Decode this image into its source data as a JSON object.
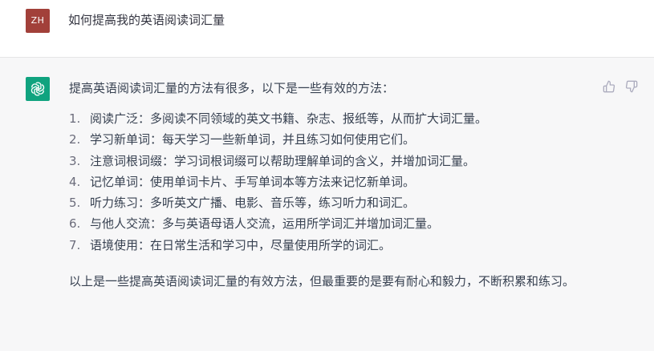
{
  "user_message": {
    "avatar_initials": "ZH",
    "avatar_color": "#a2403a",
    "text": "如何提高我的英语阅读词汇量"
  },
  "assistant_message": {
    "avatar_icon": "openai-logo-icon",
    "avatar_color": "#10a37f",
    "intro": "提高英语阅读词汇量的方法有很多，以下是一些有效的方法：",
    "steps": [
      {
        "num": "1.",
        "text": "阅读广泛：多阅读不同领域的英文书籍、杂志、报纸等，从而扩大词汇量。"
      },
      {
        "num": "2.",
        "text": "学习新单词：每天学习一些新单词，并且练习如何使用它们。"
      },
      {
        "num": "3.",
        "text": "注意词根词缀：学习词根词缀可以帮助理解单词的含义，并增加词汇量。"
      },
      {
        "num": "4.",
        "text": "记忆单词：使用单词卡片、手写单词本等方法来记忆新单词。"
      },
      {
        "num": "5.",
        "text": "听力练习：多听英文广播、电影、音乐等，练习听力和词汇。"
      },
      {
        "num": "6.",
        "text": "与他人交流：多与英语母语人交流，运用所学词汇并增加词汇量。"
      },
      {
        "num": "7.",
        "text": "语境使用：在日常生活和学习中，尽量使用所学的词汇。"
      }
    ],
    "closing": "以上是一些提高英语阅读词汇量的有效方法，但最重要的是要有耐心和毅力，不断积累和练习。"
  },
  "feedback": {
    "thumbs_up_icon": "thumbs-up-icon",
    "thumbs_down_icon": "thumbs-down-icon"
  },
  "colors": {
    "assistant_background": "#f7f7f8",
    "text": "#374151"
  }
}
